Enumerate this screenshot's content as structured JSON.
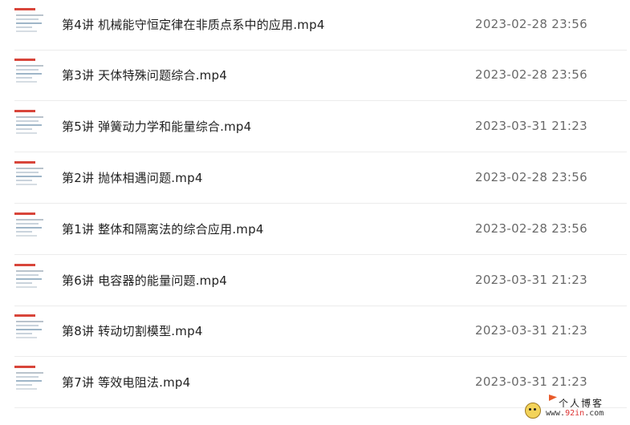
{
  "files": [
    {
      "name": "第4讲 机械能守恒定律在非质点系中的应用.mp4",
      "date": "2023-02-28 23:56"
    },
    {
      "name": "第3讲 天体特殊问题综合.mp4",
      "date": "2023-02-28 23:56"
    },
    {
      "name": "第5讲 弹簧动力学和能量综合.mp4",
      "date": "2023-03-31 21:23"
    },
    {
      "name": "第2讲 抛体相遇问题.mp4",
      "date": "2023-02-28 23:56"
    },
    {
      "name": "第1讲 整体和隔离法的综合应用.mp4",
      "date": "2023-02-28 23:56"
    },
    {
      "name": "第6讲 电容器的能量问题.mp4",
      "date": "2023-03-31 21:23"
    },
    {
      "name": "第8讲 转动切割模型.mp4",
      "date": "2023-03-31 21:23"
    },
    {
      "name": "第7讲 等效电阻法.mp4",
      "date": "2023-03-31 21:23"
    }
  ],
  "watermark": {
    "title": "个人博客",
    "url_prefix": "www.",
    "url_highlight": "92in",
    "url_suffix": ".com"
  },
  "colors": {
    "accent_red": "#d8453a",
    "text_primary": "#222222",
    "text_secondary": "#6a6a6a",
    "divider": "#ececec"
  }
}
